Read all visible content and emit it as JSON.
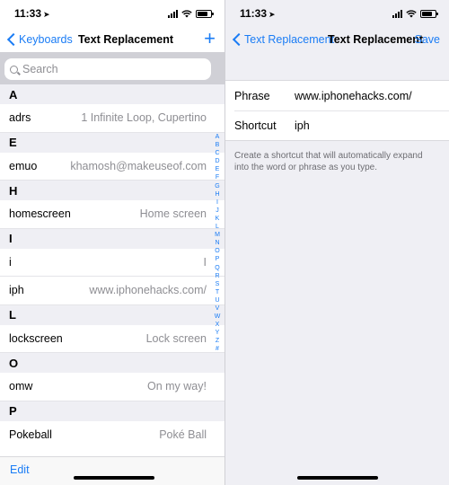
{
  "left": {
    "status": {
      "time": "11:33"
    },
    "nav": {
      "back_label": "Keyboards",
      "title": "Text Replacement",
      "add_label": "+"
    },
    "search": {
      "placeholder": "Search"
    },
    "sections": [
      {
        "letter": "A",
        "rows": [
          {
            "shortcut": "adrs",
            "phrase": "1 Infinite Loop, Cupertino"
          }
        ]
      },
      {
        "letter": "E",
        "rows": [
          {
            "shortcut": "emuo",
            "phrase": "khamosh@makeuseof.com"
          }
        ]
      },
      {
        "letter": "H",
        "rows": [
          {
            "shortcut": "homescreen",
            "phrase": "Home screen"
          }
        ]
      },
      {
        "letter": "I",
        "rows": [
          {
            "shortcut": "i",
            "phrase": "I"
          },
          {
            "shortcut": "iph",
            "phrase": "www.iphonehacks.com/"
          }
        ]
      },
      {
        "letter": "L",
        "rows": [
          {
            "shortcut": "lockscreen",
            "phrase": "Lock screen"
          }
        ]
      },
      {
        "letter": "O",
        "rows": [
          {
            "shortcut": "omw",
            "phrase": "On my way!"
          }
        ]
      },
      {
        "letter": "P",
        "rows": [
          {
            "shortcut": "Pokeball",
            "phrase": "Poké Ball"
          }
        ]
      }
    ],
    "index_letters": [
      "A",
      "B",
      "C",
      "D",
      "E",
      "F",
      "G",
      "H",
      "I",
      "J",
      "K",
      "L",
      "M",
      "N",
      "O",
      "P",
      "Q",
      "R",
      "S",
      "T",
      "U",
      "V",
      "W",
      "X",
      "Y",
      "Z",
      "#"
    ],
    "toolbar": {
      "edit_label": "Edit"
    }
  },
  "right": {
    "status": {
      "time": "11:33"
    },
    "nav": {
      "back_label": "Text Replacement",
      "title": "Text Replacement",
      "save_label": "Save"
    },
    "form": {
      "phrase_label": "Phrase",
      "phrase_value": "www.iphonehacks.com/",
      "shortcut_label": "Shortcut",
      "shortcut_value": "iph"
    },
    "note": "Create a shortcut that will automatically expand into the word or phrase as you type."
  },
  "colors": {
    "accent": "#1a7cf5",
    "secondary_text": "#8e8e93",
    "grouped_bg": "#efeff4"
  },
  "icons": [
    "location-arrow-icon",
    "signal-icon",
    "wifi-icon",
    "battery-icon",
    "chevron-left-icon",
    "plus-icon",
    "search-icon"
  ]
}
